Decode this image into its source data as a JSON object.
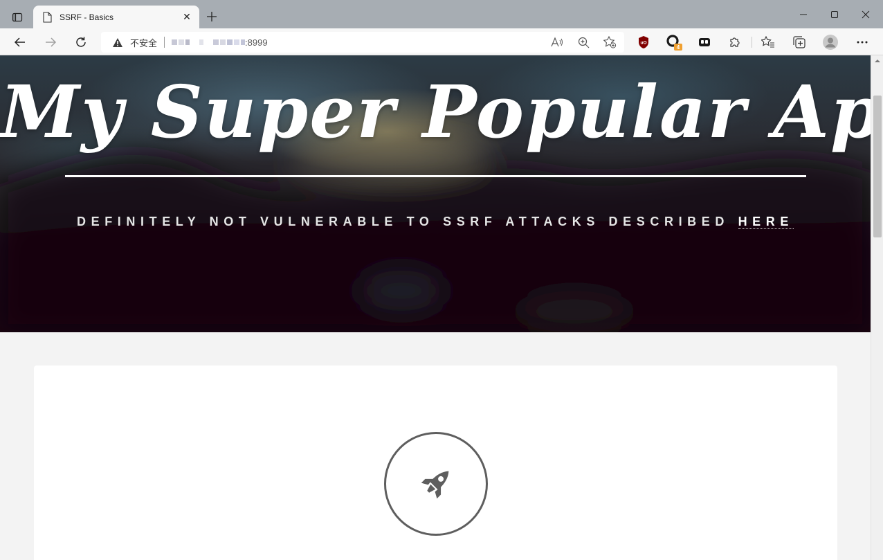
{
  "browser": {
    "tab": {
      "title": "SSRF - Basics",
      "favicon": "page-icon",
      "close_glyph": "✕"
    },
    "new_tab_glyph": "+",
    "window": {
      "minimize": "minimize-icon",
      "maximize": "maximize-icon",
      "close": "close-icon"
    },
    "address": {
      "security_icon": "warning-icon",
      "security_label": "不安全",
      "port": ":8999",
      "blurred_host": true
    },
    "omnibox_icons": [
      "read-aloud-icon",
      "zoom-icon",
      "add-favorite-icon"
    ],
    "extensions": [
      {
        "name": "ublock-icon",
        "color": "#800000"
      },
      {
        "name": "extension-badge-icon",
        "badge": "4",
        "badge_color": "#f0a030"
      },
      {
        "name": "extension-icon"
      },
      {
        "name": "extensions-puzzle-icon"
      }
    ],
    "toolbar_icons": [
      "favorites-icon",
      "collections-icon",
      "profile-avatar-icon",
      "more-menu-icon"
    ]
  },
  "page": {
    "hero": {
      "title": "My Super Popular App",
      "subtitle_prefix": "DEFINITELY NOT VULNERABLE TO SSRF ATTACKS DESCRIBED ",
      "subtitle_link": "HERE"
    },
    "card": {
      "icon": "rocket-icon"
    }
  },
  "colors": {
    "hero_text": "#ffffff",
    "page_bg": "#f3f3f3",
    "icon_gray": "#5e5e5e"
  }
}
